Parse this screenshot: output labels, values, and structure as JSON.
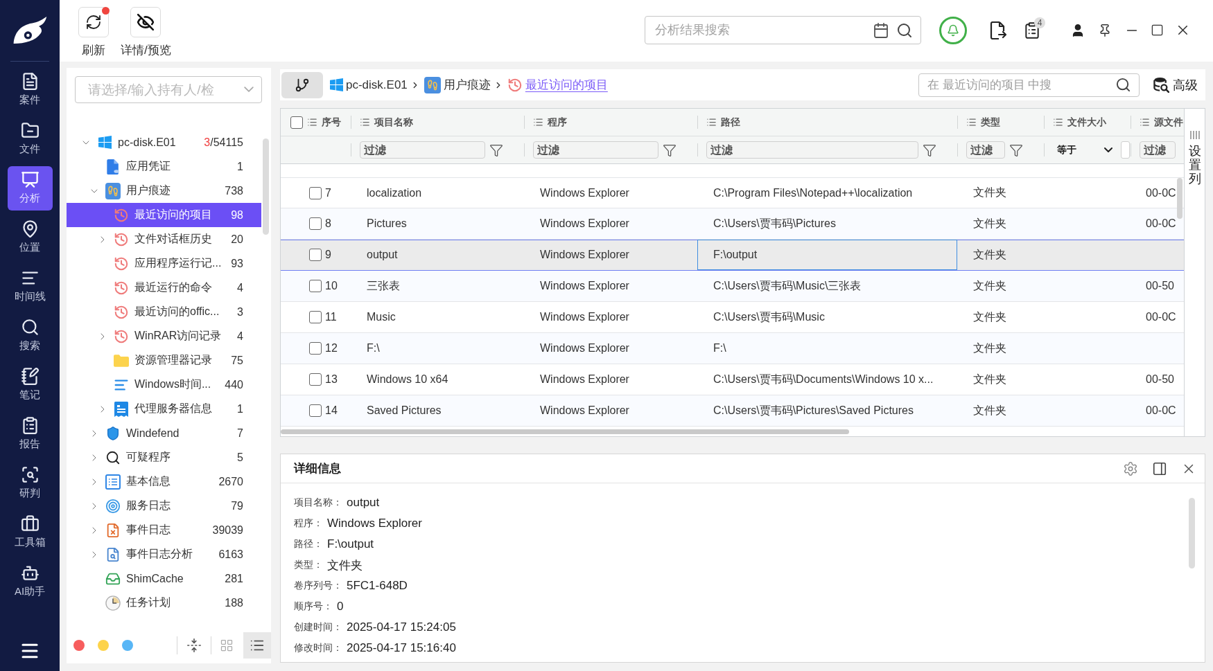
{
  "nav": {
    "items": [
      {
        "label": "案件",
        "kind": "case",
        "selected": false
      },
      {
        "label": "文件",
        "kind": "file",
        "selected": false
      },
      {
        "label": "分析",
        "kind": "analysis",
        "selected": true
      },
      {
        "label": "位置",
        "kind": "location",
        "selected": false
      },
      {
        "label": "时间线",
        "kind": "timeline",
        "selected": false
      },
      {
        "label": "搜索",
        "kind": "search",
        "selected": false
      },
      {
        "label": "笔记",
        "kind": "notes",
        "selected": false
      },
      {
        "label": "报告",
        "kind": "report",
        "selected": false
      },
      {
        "label": "研判",
        "kind": "judgement",
        "selected": false
      },
      {
        "label": "工具箱",
        "kind": "toolbox",
        "selected": false
      },
      {
        "label": "AI助手",
        "kind": "assistant",
        "selected": false
      }
    ]
  },
  "toolbar": {
    "buttons": [
      {
        "label": "刷新",
        "kind": "refresh",
        "notify": true
      },
      {
        "label": "详情/预览",
        "kind": "preview",
        "notify": false
      }
    ],
    "search": {
      "placeholder": "分析结果搜索"
    },
    "task_count": "4"
  },
  "evidence_select": {
    "placeholder": "请选择/输入持有人/检"
  },
  "tree": [
    {
      "label": "pc-disk.E01",
      "kind": "disk",
      "flagged": "3",
      "count": "/54115",
      "expanded": true,
      "selected": false,
      "children": [
        {
          "label": "应用凭证",
          "kind": "credential",
          "count": "1",
          "selected": false
        },
        {
          "label": "用户痕迹",
          "kind": "traces",
          "count": "738",
          "expanded": true,
          "selected": false,
          "children": [
            {
              "label": "最近访问的项目",
              "kind": "history",
              "count": "98",
              "selected": true
            },
            {
              "label": "文件对话框历史",
              "kind": "history",
              "count": "20",
              "expanded": false,
              "selected": false
            },
            {
              "label": "应用程序运行记...",
              "kind": "history",
              "count": "93",
              "selected": false
            },
            {
              "label": "最近运行的命令",
              "kind": "history",
              "count": "4",
              "selected": false
            },
            {
              "label": "最近访问的offic...",
              "kind": "history",
              "count": "3",
              "selected": false
            },
            {
              "label": "WinRAR访问记录",
              "kind": "history",
              "count": "4",
              "expanded": false,
              "selected": false
            },
            {
              "label": "资源管理器记录",
              "kind": "folder",
              "count": "75",
              "selected": false
            },
            {
              "label": "Windows时间...",
              "kind": "timeline",
              "count": "440",
              "selected": false
            },
            {
              "label": "代理服务器信息",
              "kind": "proxy",
              "count": "1",
              "expanded": false,
              "selected": false
            }
          ]
        },
        {
          "label": "Windefend",
          "kind": "shield",
          "count": "7",
          "expanded": false,
          "selected": false
        },
        {
          "label": "可疑程序",
          "kind": "suspicious",
          "count": "5",
          "expanded": false,
          "selected": false
        },
        {
          "label": "基本信息",
          "kind": "info",
          "count": "2670",
          "expanded": false,
          "selected": false
        },
        {
          "label": "服务日志",
          "kind": "service",
          "count": "79",
          "expanded": false,
          "selected": false
        },
        {
          "label": "事件日志",
          "kind": "eventlog",
          "count": "39039",
          "expanded": false,
          "selected": false
        },
        {
          "label": "事件日志分析",
          "kind": "eventanalysis",
          "count": "6163",
          "expanded": false,
          "selected": false
        },
        {
          "label": "ShimCache",
          "kind": "shimcache",
          "count": "281",
          "selected": false
        },
        {
          "label": "任务计划",
          "kind": "schedule",
          "count": "188",
          "selected": false
        }
      ]
    }
  ],
  "color_tags": [
    {
      "color": "#f75d5d"
    },
    {
      "color": "#fdd34a"
    },
    {
      "color": "#58b6f6"
    }
  ],
  "view_modes": [
    {
      "kind": "grid",
      "selected": false
    },
    {
      "kind": "list",
      "selected": true
    }
  ],
  "breadcrumb": [
    {
      "label": "pc-disk.E01",
      "kind": "disk",
      "current": false
    },
    {
      "label": "用户痕迹",
      "kind": "traces",
      "current": false
    },
    {
      "label": "最近访问的项目",
      "kind": "history",
      "current": true
    }
  ],
  "scope_search": {
    "placeholder": "在 最近访问的项目 中搜"
  },
  "advanced_button": "高级",
  "table": {
    "all_checked": false,
    "columns": [
      {
        "label": "序号"
      },
      {
        "label": "项目名称",
        "filter": {
          "kind": "text",
          "placeholder": "过滤",
          "funnel": true
        }
      },
      {
        "label": "程序",
        "filter": {
          "kind": "text",
          "placeholder": "过滤",
          "funnel": true
        }
      },
      {
        "label": "路径",
        "filter": {
          "kind": "text",
          "placeholder": "过滤",
          "funnel": true
        }
      },
      {
        "label": "类型",
        "filter": {
          "kind": "text",
          "placeholder": "过滤",
          "funnel": true
        }
      },
      {
        "label": "文件大小",
        "filter": {
          "kind": "select",
          "value": "等于"
        }
      },
      {
        "label": "源文件",
        "filter": {
          "kind": "text",
          "placeholder": "过滤",
          "funnel": false
        }
      }
    ],
    "rows": [
      {
        "seq": "7",
        "name": "localization",
        "program": "Windows Explorer",
        "path": "C:\\Program Files\\Notepad++\\localization",
        "type": "文件夹",
        "source_file": "00-0C",
        "checked": false,
        "selected": false,
        "path_focused": false
      },
      {
        "seq": "8",
        "name": "Pictures",
        "program": "Windows Explorer",
        "path": "C:\\Users\\贾韦码\\Pictures",
        "type": "文件夹",
        "source_file": "00-0C",
        "checked": false,
        "selected": false,
        "path_focused": false
      },
      {
        "seq": "9",
        "name": "output",
        "program": "Windows Explorer",
        "path": "F:\\output",
        "type": "文件夹",
        "checked": false,
        "selected": true,
        "path_focused": true
      },
      {
        "seq": "10",
        "name": "三张表",
        "program": "Windows Explorer",
        "path": "C:\\Users\\贾韦码\\Music\\三张表",
        "type": "文件夹",
        "source_file": "00-50",
        "checked": false,
        "selected": false,
        "path_focused": false
      },
      {
        "seq": "11",
        "name": "Music",
        "program": "Windows Explorer",
        "path": "C:\\Users\\贾韦码\\Music",
        "type": "文件夹",
        "source_file": "00-0C",
        "checked": false,
        "selected": false,
        "path_focused": false
      },
      {
        "seq": "12",
        "name": "F:\\",
        "program": "Windows Explorer",
        "path": "F:\\",
        "type": "文件夹",
        "checked": false,
        "selected": false,
        "path_focused": false
      },
      {
        "seq": "13",
        "name": "Windows 10 x64",
        "program": "Windows Explorer",
        "path": "C:\\Users\\贾韦码\\Documents\\Windows 10 x...",
        "type": "文件夹",
        "source_file": "00-50",
        "checked": false,
        "selected": false,
        "path_focused": false
      },
      {
        "seq": "14",
        "name": "Saved Pictures",
        "program": "Windows Explorer",
        "path": "C:\\Users\\贾韦码\\Pictures\\Saved Pictures",
        "type": "文件夹",
        "source_file": "00-0C",
        "checked": false,
        "selected": false,
        "path_focused": false
      }
    ],
    "column_settings": "设置列"
  },
  "detail": {
    "title": "详细信息",
    "fields": [
      {
        "label": "项目名称：",
        "value": "output"
      },
      {
        "label": "程序：",
        "value": "Windows Explorer"
      },
      {
        "label": "路径：",
        "value": "F:\\output"
      },
      {
        "label": "类型：",
        "value": "文件夹"
      },
      {
        "label": "卷序列号：",
        "value": "5FC1-648D"
      },
      {
        "label": "顺序号：",
        "value": "0"
      },
      {
        "label": "创建时间：",
        "value": "2025-04-17 15:24:05"
      },
      {
        "label": "修改时间：",
        "value": "2025-04-17 15:16:40"
      }
    ]
  }
}
